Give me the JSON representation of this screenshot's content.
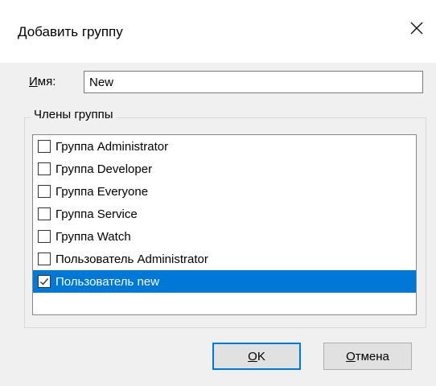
{
  "dialog": {
    "title": "Добавить группу",
    "close_icon": "close-icon"
  },
  "name_field": {
    "label_first": "И",
    "label_rest": "мя:",
    "value": "New"
  },
  "members": {
    "legend": "Члены группы",
    "items": [
      {
        "label": "Группа Administrator",
        "checked": false,
        "selected": false
      },
      {
        "label": "Группа Developer",
        "checked": false,
        "selected": false
      },
      {
        "label": "Группа Everyone",
        "checked": false,
        "selected": false
      },
      {
        "label": "Группа Service",
        "checked": false,
        "selected": false
      },
      {
        "label": "Группа Watch",
        "checked": false,
        "selected": false
      },
      {
        "label": "Пользователь Administrator",
        "checked": false,
        "selected": false
      },
      {
        "label": "Пользователь new",
        "checked": true,
        "selected": true
      }
    ]
  },
  "buttons": {
    "ok_first": "O",
    "ok_rest": "K",
    "cancel_first": "О",
    "cancel_rest": "тмена"
  },
  "colors": {
    "selection": "#0078d7",
    "background": "#f0f0f0",
    "titlebar": "#ffffff"
  }
}
